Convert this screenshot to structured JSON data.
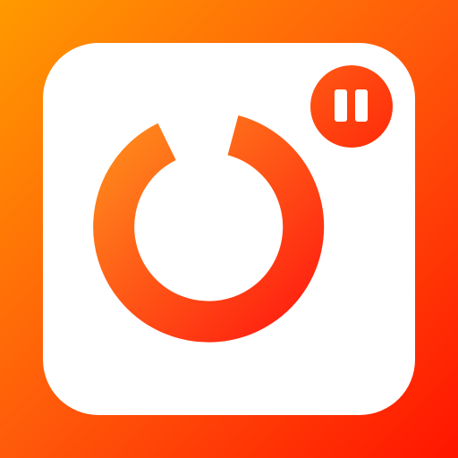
{
  "icon": {
    "name": "app-icon",
    "symbol": "circular-timer-icon",
    "badge": "pause-icon"
  },
  "colors": {
    "gradient_start": "#FF9800",
    "gradient_end": "#FF1500",
    "card": "#FFFFFF",
    "accent_light": "#FF7A1E",
    "accent_dark": "#FF2A0E"
  }
}
